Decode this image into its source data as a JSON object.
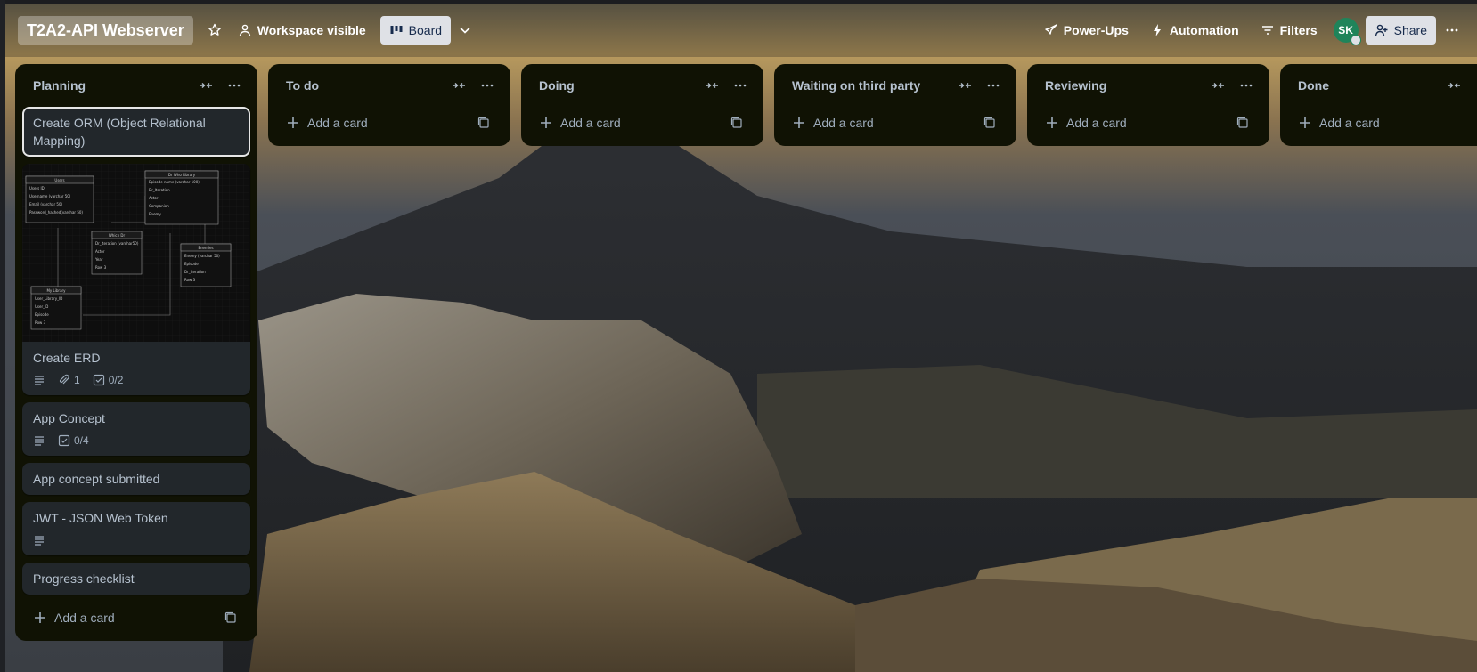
{
  "board": {
    "title": "T2A2-API Webserver",
    "visibility_label": "Workspace visible",
    "view_label": "Board"
  },
  "header_right": {
    "powerups_label": "Power-Ups",
    "automation_label": "Automation",
    "filters_label": "Filters",
    "avatar_initials": "SK",
    "share_label": "Share"
  },
  "icons": {
    "star": "star-icon",
    "visibility": "people-icon",
    "board_view": "board-icon",
    "chevron": "chevron-down-icon",
    "powerups": "rocket-icon",
    "automation": "lightning-icon",
    "filters": "filter-icon",
    "collapse": "collapse-icon",
    "more": "ellipsis-icon",
    "add": "plus-icon",
    "template": "template-icon",
    "description": "description-icon",
    "attachment": "paperclip-icon",
    "checklist": "checklist-icon"
  },
  "colors": {
    "list_bg": "#101204",
    "card_bg": "#22272b",
    "avatar": "#1f845a",
    "text": "#b6c2cf"
  },
  "lists": [
    {
      "title": "Planning",
      "add_label": "Add a card",
      "cards": [
        {
          "title": "Create ORM (Object Relational Mapping)"
        },
        {
          "title": "Create ERD",
          "attachments": "1",
          "checklist": "0/2"
        },
        {
          "title": "App Concept",
          "checklist": "0/4"
        },
        {
          "title": "App concept submitted"
        },
        {
          "title": "JWT - JSON Web Token"
        },
        {
          "title": "Progress checklist"
        }
      ]
    },
    {
      "title": "To do",
      "add_label": "Add a card"
    },
    {
      "title": "Doing",
      "add_label": "Add a card"
    },
    {
      "title": "Waiting on third party",
      "add_label": "Add a card"
    },
    {
      "title": "Reviewing",
      "add_label": "Add a card"
    },
    {
      "title": "Done",
      "add_label": "Add a card"
    }
  ],
  "erd": {
    "tables": [
      {
        "name": "Users",
        "pk": "Users ID",
        "rows": [
          "Username (varchar 50)",
          "Email (varchar 50)",
          "Password_hashed(varchar 50)"
        ]
      },
      {
        "name": "Dr Who Library",
        "pk": "Episode name (varchar 100)",
        "rows": [
          "Dr_Iteration",
          "Actor",
          "Companion",
          "Enemy"
        ]
      },
      {
        "name": "Which Dr",
        "pk": "Dr_Iteration (varchar50)",
        "rows": [
          "Actor",
          "Year",
          "Row 3"
        ]
      },
      {
        "name": "Enemies",
        "pk": "Enemy (varchar 50)",
        "rows": [
          "Episode",
          "Dr_Iteration",
          "Row 3"
        ]
      },
      {
        "name": "My Library",
        "pk": "User_Library_ID",
        "rows": [
          "User_ID",
          "Episode",
          "Row 3"
        ]
      }
    ]
  }
}
